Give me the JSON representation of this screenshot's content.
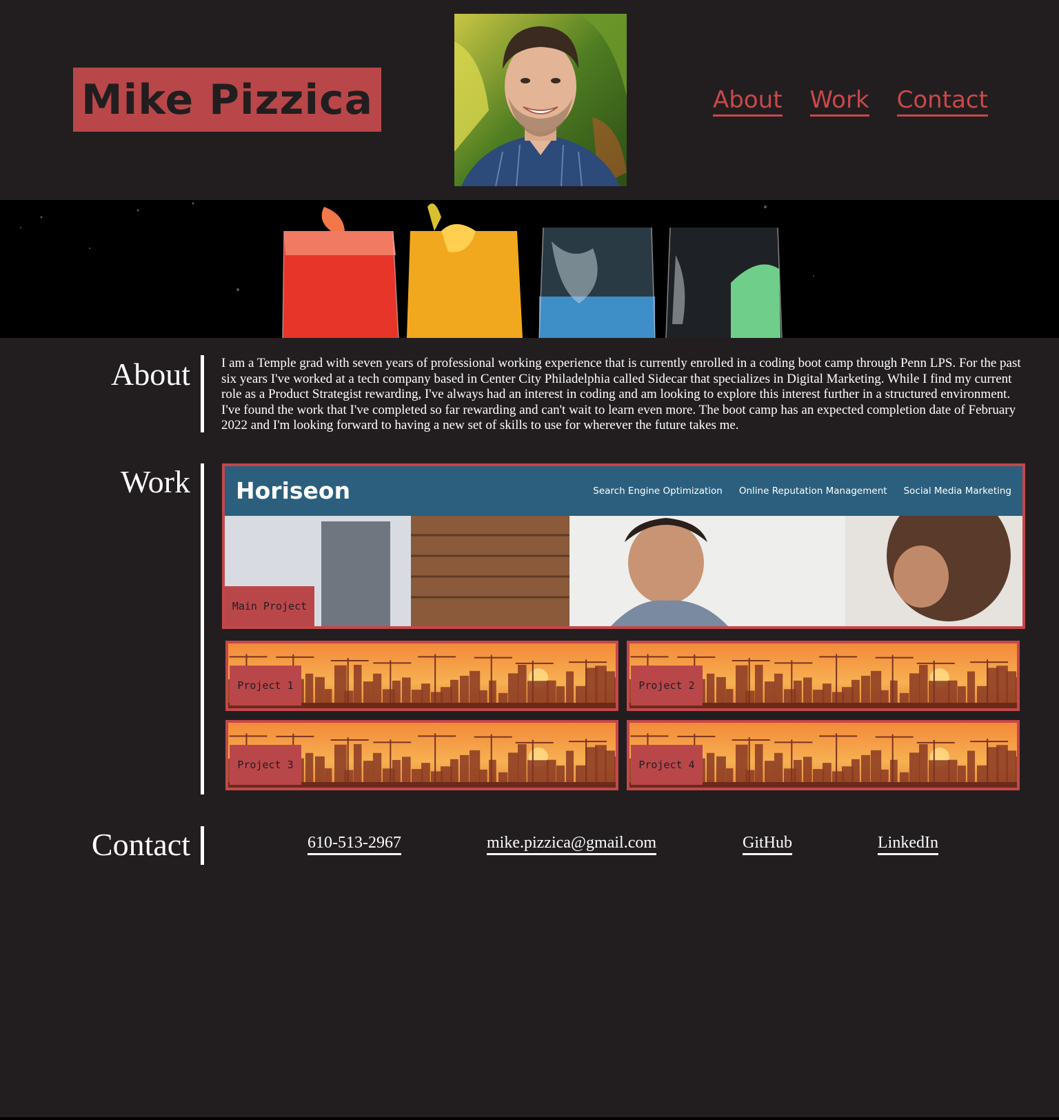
{
  "header": {
    "name": "Mike Pizzica",
    "nav": [
      "About",
      "Work",
      "Contact"
    ]
  },
  "about": {
    "title": "About",
    "text": "I am a Temple grad with seven years of professional working experience that is currently enrolled in a coding boot camp through Penn LPS. For the past six years I've worked at a tech company based in Center City Philadelphia called Sidecar that specializes in Digital Marketing. While I find my current role as a Product Strategist rewarding, I've always had an interest in coding and am looking to explore this interest further in a structured environment. I've found the work that I've completed so far rewarding and can't wait to learn even more. The boot camp has an expected completion date of February 2022 and I'm looking forward to having a new set of skills to use for wherever the future takes me."
  },
  "work": {
    "title": "Work",
    "main_project": {
      "label": "Main Project",
      "screenshot_logo": "Horiseon",
      "screenshot_links": [
        "Search Engine Optimization",
        "Online Reputation Management",
        "Social Media Marketing"
      ]
    },
    "projects": [
      "Project 1",
      "Project 2",
      "Project 3",
      "Project 4"
    ]
  },
  "contact": {
    "title": "Contact",
    "phone": "610-513-2967",
    "email": "mike.pizzica@gmail.com",
    "github": "GitHub",
    "linkedin": "LinkedIn"
  },
  "colors": {
    "background": "#221e1f",
    "accent": "#b9474a",
    "text": "#ffffff"
  }
}
